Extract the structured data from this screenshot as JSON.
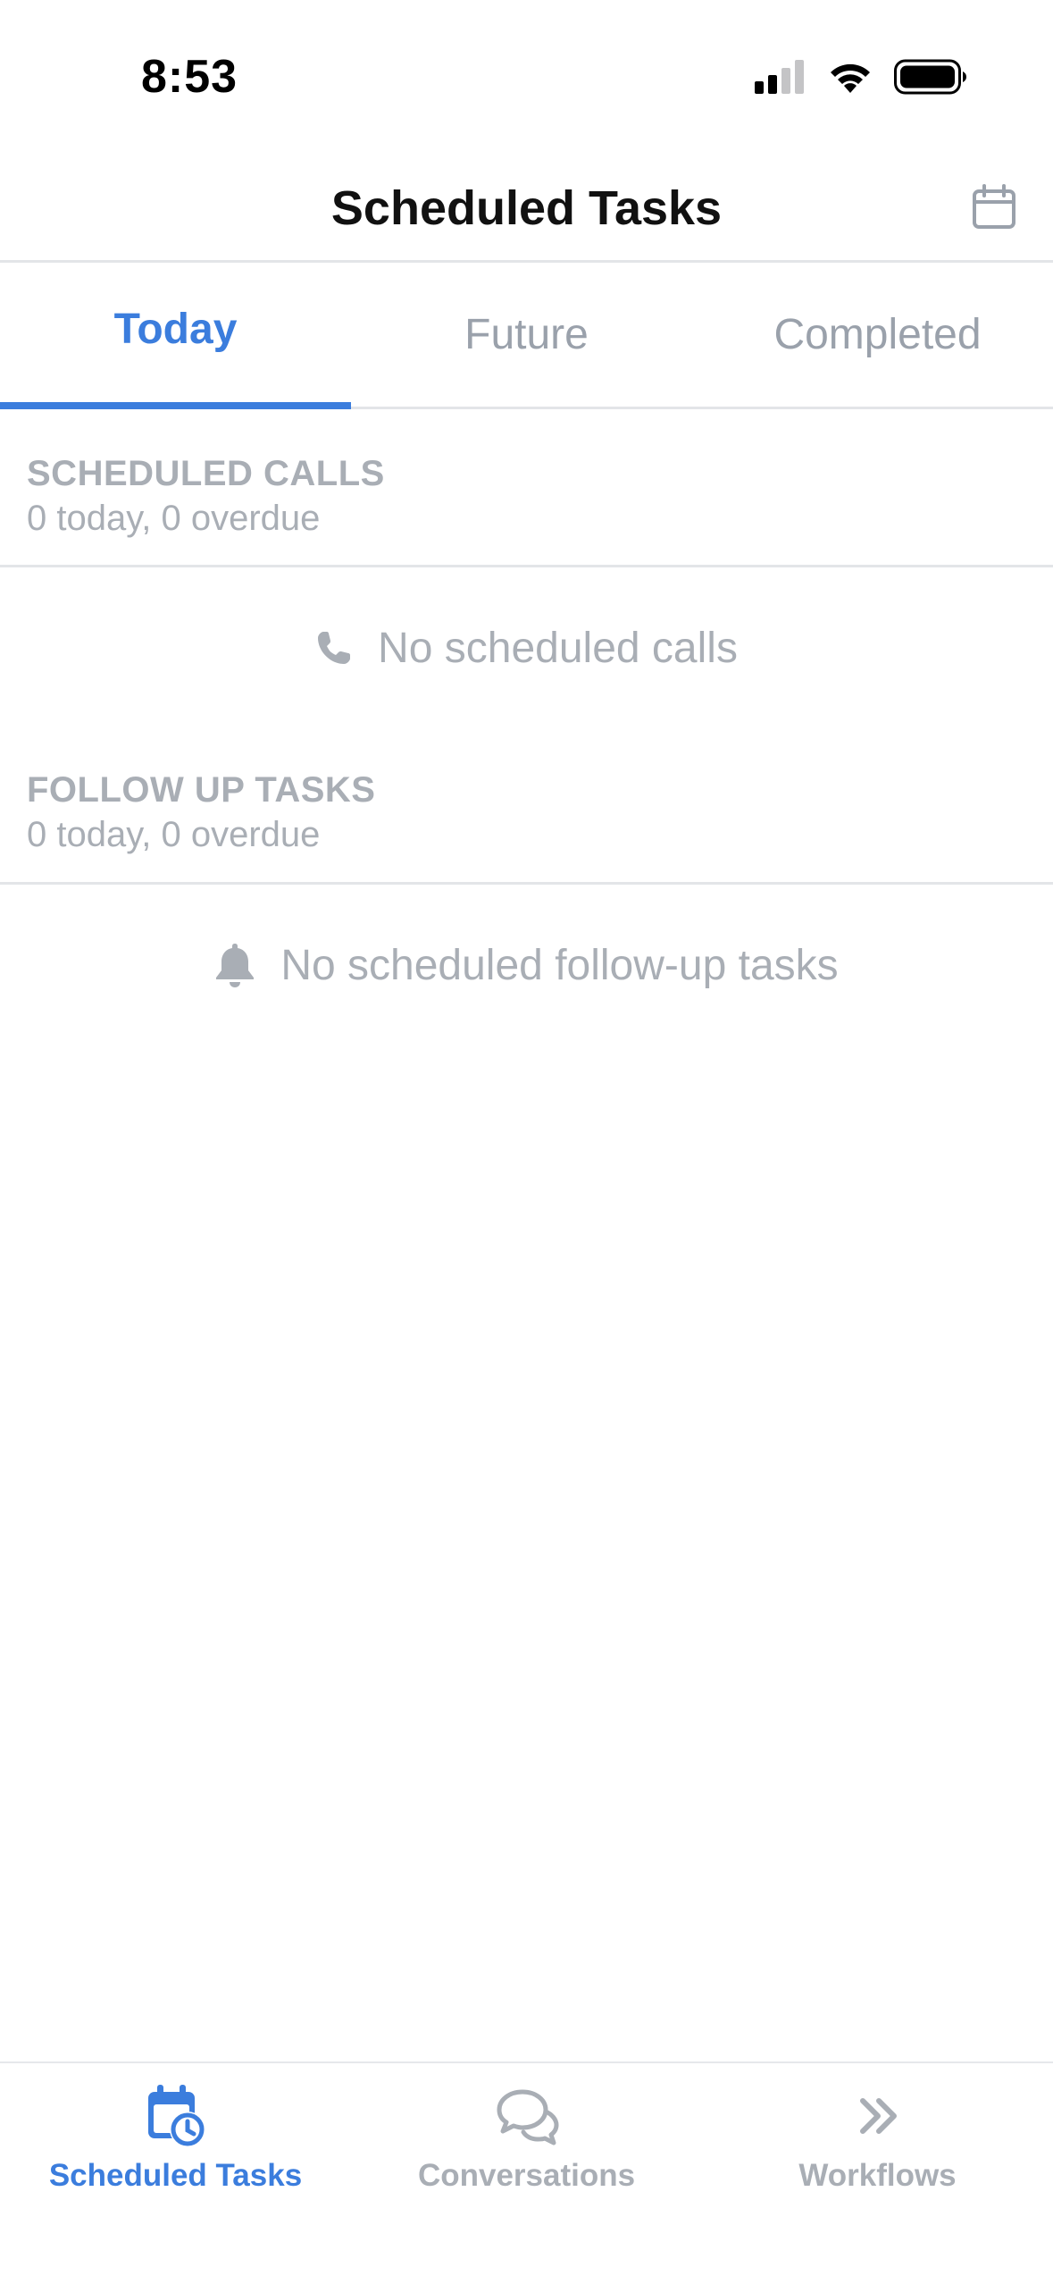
{
  "status_bar": {
    "time": "8:53"
  },
  "header": {
    "title": "Scheduled Tasks",
    "calendar_icon": "calendar-icon"
  },
  "tabs": [
    {
      "label": "Today",
      "active": true
    },
    {
      "label": "Future",
      "active": false
    },
    {
      "label": "Completed",
      "active": false
    }
  ],
  "sections": {
    "calls": {
      "title": "SCHEDULED CALLS",
      "subtitle": "0 today, 0 overdue",
      "empty_text": "No scheduled calls",
      "icon": "phone-icon"
    },
    "follow_up": {
      "title": "FOLLOW UP TASKS",
      "subtitle": "0 today, 0 overdue",
      "empty_text": "No scheduled follow-up tasks",
      "icon": "bell-icon"
    }
  },
  "tab_bar": [
    {
      "label": "Scheduled Tasks",
      "icon": "calendar-clock-icon",
      "active": true
    },
    {
      "label": "Conversations",
      "icon": "chat-bubbles-icon",
      "active": false
    },
    {
      "label": "Workflows",
      "icon": "double-chevron-right-icon",
      "active": false
    }
  ],
  "colors": {
    "accent": "#3b7ddd",
    "muted": "#a9aeb5",
    "divider": "#e3e5e8"
  }
}
